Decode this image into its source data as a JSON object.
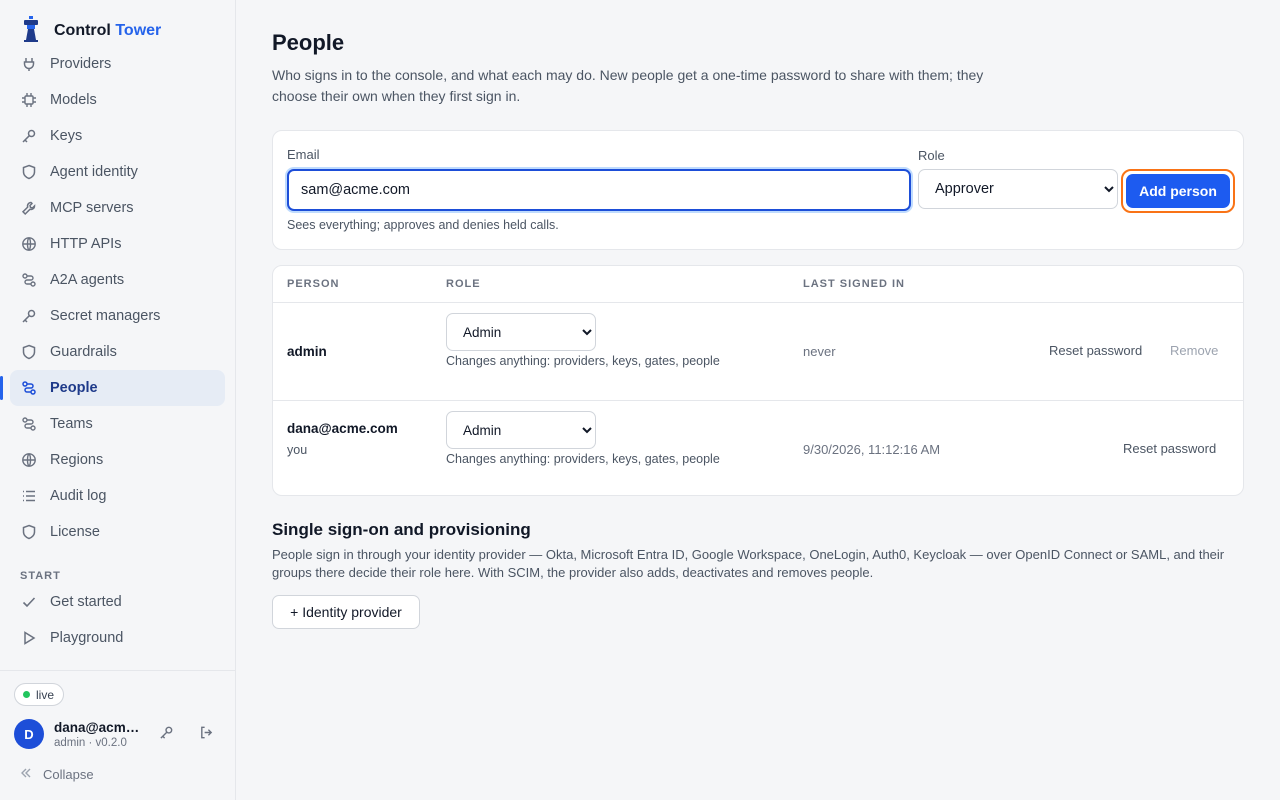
{
  "brand": {
    "name_primary": "Control",
    "name_accent": "Tower"
  },
  "sidebar": {
    "items": [
      {
        "label": "Providers",
        "icon": "plug-icon"
      },
      {
        "label": "Models",
        "icon": "chip-icon"
      },
      {
        "label": "Keys",
        "icon": "key-icon"
      },
      {
        "label": "Agent identity",
        "icon": "shield-icon"
      },
      {
        "label": "MCP servers",
        "icon": "wrench-icon"
      },
      {
        "label": "HTTP APIs",
        "icon": "globe-icon"
      },
      {
        "label": "A2A agents",
        "icon": "network-icon"
      },
      {
        "label": "Secret managers",
        "icon": "key-icon"
      },
      {
        "label": "Guardrails",
        "icon": "shield-icon"
      },
      {
        "label": "People",
        "icon": "people-icon",
        "active": true
      },
      {
        "label": "Teams",
        "icon": "network-icon"
      },
      {
        "label": "Regions",
        "icon": "globe-icon"
      },
      {
        "label": "Audit log",
        "icon": "list-icon"
      },
      {
        "label": "License",
        "icon": "shield-icon"
      }
    ],
    "section_start": "START",
    "start_items": [
      {
        "label": "Get started",
        "icon": "check-icon"
      },
      {
        "label": "Playground",
        "icon": "play-icon"
      }
    ],
    "status": "live",
    "user": {
      "initial": "D",
      "email": "dana@acme.com",
      "meta": "admin · v0.2.0"
    },
    "collapse_label": "Collapse"
  },
  "page": {
    "title": "People",
    "description": "Who signs in to the console, and what each may do. New people get a one-time password to share with them; they choose their own when they first sign in."
  },
  "add_form": {
    "email_label": "Email",
    "email_value": "sam@acme.com",
    "role_label": "Role",
    "role_value": "Approver",
    "add_button": "Add person",
    "role_help": "Sees everything; approves and denies held calls."
  },
  "table": {
    "headers": [
      "PERSON",
      "ROLE",
      "LAST SIGNED IN"
    ],
    "rows": [
      {
        "name": "admin",
        "sub": "",
        "role": "Admin",
        "role_help": "Changes anything: providers, keys, gates, people",
        "last_signed_in": "never",
        "reset_label": "Reset password",
        "remove_label": "Remove"
      },
      {
        "name": "dana@acme.com",
        "sub": "you",
        "role": "Admin",
        "role_help": "Changes anything: providers, keys, gates, people",
        "last_signed_in": "9/30/2026, 11:12:16 AM",
        "reset_label": "Reset password"
      }
    ]
  },
  "sso": {
    "title": "Single sign-on and provisioning",
    "description": "People sign in through your identity provider — Okta, Microsoft Entra ID, Google Workspace, OneLogin, Auth0, Keycloak — over OpenID Connect or SAML, and their groups there decide their role here. With SCIM, the provider also adds, deactivates and removes people.",
    "button": "+ Identity provider"
  }
}
